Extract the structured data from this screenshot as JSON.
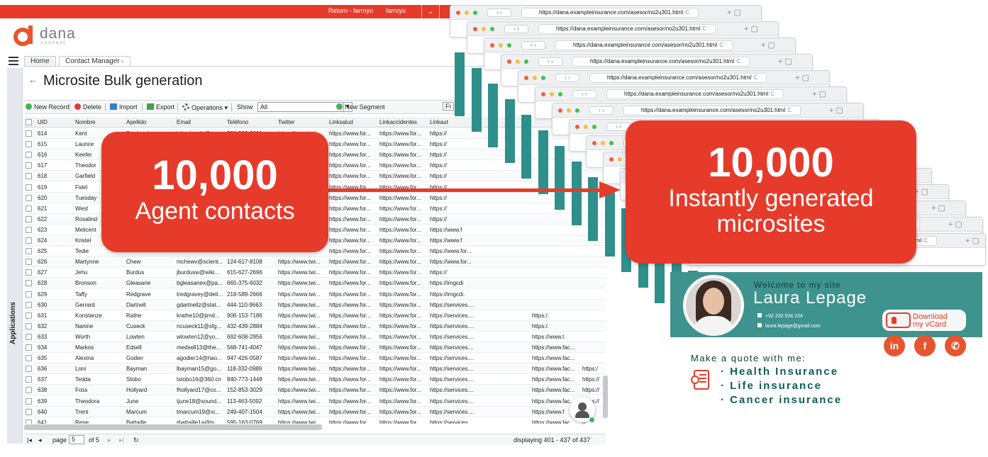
{
  "topbar": {
    "return_label": "Return - farroyo",
    "user": "farroyo",
    "chevron": "⌄"
  },
  "logo": {
    "word": "dana",
    "sub": "connect"
  },
  "sidebar": {
    "label": "Applications"
  },
  "tabs": [
    {
      "label": "Home"
    },
    {
      "label": "Contact Manager",
      "close": "×"
    }
  ],
  "page": {
    "back": "←",
    "title": "Microsite Bulk generation"
  },
  "toolbar": {
    "new_record": "New Record",
    "delete": "Delete",
    "import": "Import",
    "export": "Export",
    "operations": "Operations",
    "show_label": "Show",
    "show_value": "All",
    "new_segment": "New Segment",
    "filter_cut": "Fi"
  },
  "table": {
    "columns": [
      "UID",
      "Nombre",
      "Apellido",
      "Email",
      "Teléfono",
      "Twitter",
      "Linksalud",
      "Linkaccidentes",
      "Linkaut"
    ],
    "rows": [
      [
        "614",
        "Kent",
        "Brudenelp",
        "kdrudenelp@...",
        "760-593-5001",
        "https://www.twi...",
        "https://www.for...",
        "https://www.for...",
        "https://"
      ],
      [
        "615",
        "Launce",
        "",
        "",
        "",
        "",
        "https://www.for...",
        "https://www.for...",
        "https://"
      ],
      [
        "616",
        "Keefer",
        "",
        "",
        "",
        "",
        "https://www.for...",
        "https://www.for...",
        "https://"
      ],
      [
        "617",
        "Theodor",
        "",
        "",
        "",
        "",
        "https://www.for...",
        "https://www.for...",
        "https://"
      ],
      [
        "618",
        "Garfield",
        "",
        "",
        "",
        "",
        "https://www.for...",
        "https://www.for...",
        "https://"
      ],
      [
        "619",
        "Fidel",
        "",
        "",
        "",
        "",
        "https://www.for...",
        "https://www.for...",
        "https://"
      ],
      [
        "620",
        "Tuesday",
        "",
        "",
        "",
        "",
        "https://www.for...",
        "https://www.for...",
        "https://"
      ],
      [
        "621",
        "West",
        "",
        "",
        "",
        "",
        "https://www.for...",
        "https://www.for...",
        "https://"
      ],
      [
        "622",
        "Rosalind",
        "",
        "",
        "",
        "",
        "https://www.for...",
        "https://www.for...",
        "https://"
      ],
      [
        "623",
        "Melicent",
        "",
        "",
        "",
        "",
        "https://www.for...",
        "https://www.for...",
        "https://www.f"
      ],
      [
        "624",
        "Kristel",
        "",
        "",
        "",
        "",
        "https://www.for...",
        "https://www.for...",
        "https://www.f"
      ],
      [
        "625",
        "Tedie",
        "",
        "",
        "",
        "",
        "https://www.for...",
        "https://www.for...",
        "https://www.for..."
      ],
      [
        "626",
        "Martynne",
        "Chew",
        "mchewv@scient...",
        "124-617-8108",
        "https://www.twi...",
        "https://www.for...",
        "https://www.for...",
        "https://www.for..."
      ],
      [
        "627",
        "Jehu",
        "Burdus",
        "jburdusw@wiki...",
        "615-627-2696",
        "https://www.twi...",
        "https://www.for...",
        "https://www.for...",
        "https://"
      ],
      [
        "628",
        "Bronson",
        "Gleasane",
        "bgleasanex@pa...",
        "665-375-6032",
        "https://www.twi...",
        "https://www.for...",
        "https://www.for...",
        "https://imgcdi"
      ],
      [
        "629",
        "Taffy",
        "Redgrave",
        "tredgravey@deli...",
        "218-589-2666",
        "https://www.twi...",
        "https://www.for...",
        "https://www.for...",
        "https://imgcdi."
      ],
      [
        "630",
        "Gerrard",
        "Dartnell",
        "gdartnellz@stat...",
        "444-110-9663",
        "https://www.twi...",
        "https://www.for...",
        "https://www.for...",
        "https://services...."
      ],
      [
        "631",
        "Konstanze",
        "Rathe",
        "krathe10@jimd...",
        "906-153-7186",
        "https://www.twi...",
        "https://www.for...",
        "https://www.for...",
        "https://services...."
      ],
      [
        "632",
        "Nanine",
        "Cuseck",
        "ncuseck11@sfg...",
        "432-439-2884",
        "https://www.twi...",
        "https://www.for...",
        "https://www.for...",
        "https://services...."
      ],
      [
        "633",
        "Worth",
        "Lowten",
        "wlowten12@yo...",
        "692-608-2956",
        "https://www.twi...",
        "https://www.for...",
        "https://www.for...",
        "https://services...."
      ],
      [
        "634",
        "Markos",
        "Edsell",
        "medsell13@the...",
        "568-741-4047",
        "https://www.twi...",
        "https://www.for...",
        "https://www.for...",
        "https://services...."
      ],
      [
        "635",
        "Alexina",
        "Godier",
        "agodier14@hao...",
        "947-426-0587",
        "https://www.twi...",
        "https://www.for...",
        "https://www.for...",
        "https://services...."
      ],
      [
        "636",
        "Loni",
        "Bayman",
        "lbayman15@go...",
        "118-332-0989",
        "https://www.twi...",
        "https://www.for...",
        "https://www.for...",
        "https://services...."
      ],
      [
        "637",
        "Tedda",
        "Stobo",
        "tstobo16@360.cn",
        "840-773-1448",
        "https://www.twi...",
        "https://www.for...",
        "https://www.for...",
        "https://services...."
      ],
      [
        "638",
        "Foss",
        "Hollyard",
        "fhollyard17@co...",
        "152-853-3029",
        "https://www.twi...",
        "https://www.for...",
        "https://www.for...",
        "https://services...."
      ],
      [
        "639",
        "Theodora",
        "June",
        "tjune18@sound...",
        "113-463-5092",
        "https://www.twi...",
        "https://www.for...",
        "https://www.for...",
        "https://services...."
      ],
      [
        "640",
        "Trent",
        "Marcum",
        "tmarcum19@xi...",
        "249-407-1504",
        "https://www.twi...",
        "https://www.for...",
        "https://www.for...",
        "https://services...."
      ],
      [
        "641",
        "Rene",
        "Battaille",
        "rbattaille1a@ty...",
        "595-163-0769",
        "https://www.twi...",
        "https://www.for...",
        "https://www.for...",
        "https://services...."
      ]
    ],
    "extra_cols": {
      "631": [
        "https:/."
      ],
      "632": [
        "https:/."
      ],
      "633": [
        "https://www.t"
      ],
      "634": [
        "https://www.fac..."
      ],
      "635": [
        "https://www.fac..."
      ],
      "636": [
        "https://www.fac...",
        "https:/"
      ],
      "637": [
        "https://www.fac...",
        "https://"
      ],
      "638": [
        "https://www.fac...",
        "https://"
      ],
      "639": [
        "https://www.fac...",
        "https://"
      ],
      "640": [
        "https://www.f",
        "//"
      ],
      "641": [
        "https://www.fac",
        "//"
      ]
    }
  },
  "pager": {
    "first": "|◂",
    "prev": "◂",
    "page_label": "page",
    "page_value": "5",
    "of": "of 5",
    "next": "▸",
    "last": "▸|",
    "refresh": "↻",
    "displaying": "displaying 401 - 437 of 437"
  },
  "browser": {
    "url": "https://dana.exampleinsurance.com/asesor/no2u301.html",
    "nav": "‹  ›",
    "reload": "C",
    "plus": "+ ▢",
    "colors": {
      "red": "#f25a45",
      "yellow": "#f6be3c",
      "green": "#3fc14f"
    }
  },
  "callout_left": {
    "big": "10,000",
    "label": "Agent  contacts"
  },
  "callout_right": {
    "big": "10,000",
    "line1": "Instantly generated",
    "line2": "microsites"
  },
  "profile": {
    "welcome": "Welcome to my site",
    "name": "Laura Lepage",
    "phone": "+92 232 534 234",
    "email": "laura.lepage@gmail.com",
    "vcard_line1": "Download",
    "vcard_line2": "my vCard",
    "social": [
      "in",
      "f",
      "✆"
    ],
    "quote_title": "Make a quote with me:",
    "products": [
      "· Health Insurance",
      "· Life insurance",
      "· Cancer insurance"
    ]
  },
  "colors": {
    "accent_red": "#e63b2a",
    "teal": "#3f938f",
    "dark_teal": "#0d5e5a"
  }
}
